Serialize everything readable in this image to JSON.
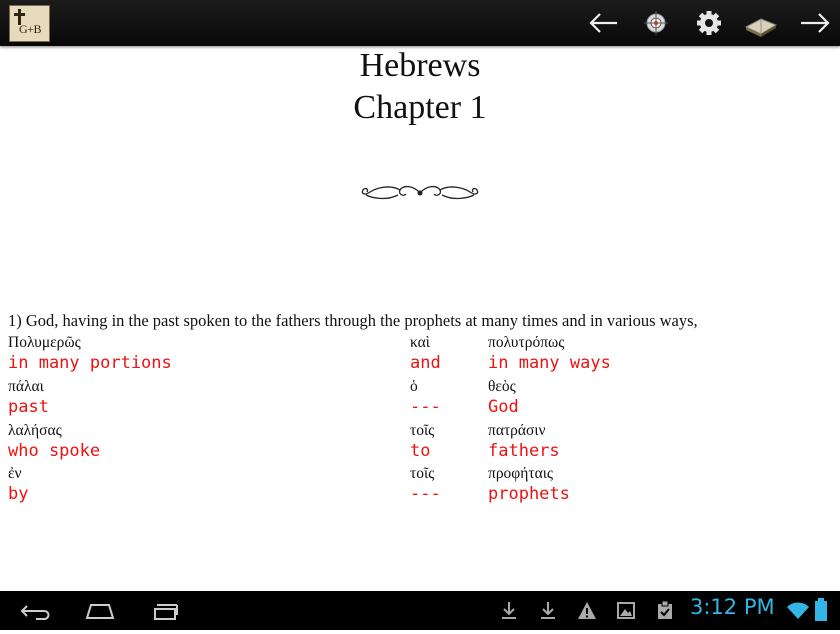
{
  "app": {
    "logo_text": "G+B"
  },
  "heading": {
    "book": "Hebrews",
    "chapter": "Chapter 1"
  },
  "verse": {
    "text": "1) God, having in the past spoken to the fathers through the prophets at many times and in various ways,"
  },
  "interlinear": [
    {
      "greek": "Πολυμερῶς",
      "english": "in many portions"
    },
    {
      "greek": "καὶ",
      "english": "and"
    },
    {
      "greek": "πολυτρόπως",
      "english": "in many ways"
    },
    {
      "greek": "πάλαι",
      "english": "past"
    },
    {
      "greek": "ὁ",
      "english": "---"
    },
    {
      "greek": "θεὸς",
      "english": "God"
    },
    {
      "greek": "λαλήσας",
      "english": "who spoke"
    },
    {
      "greek": "τοῖς",
      "english": "to"
    },
    {
      "greek": "πατράσιν",
      "english": "fathers"
    },
    {
      "greek": "ἐν",
      "english": "by"
    },
    {
      "greek": "τοῖς",
      "english": "---"
    },
    {
      "greek": "προφήταις",
      "english": "prophets"
    }
  ],
  "toolbar": {
    "icons": [
      "back-arrow-icon",
      "compass-icon",
      "gear-icon",
      "book-icon",
      "forward-arrow-icon"
    ]
  },
  "system": {
    "time": "3:12 PM",
    "accent_color": "#33b5e5",
    "english_color": "#ee1111"
  }
}
